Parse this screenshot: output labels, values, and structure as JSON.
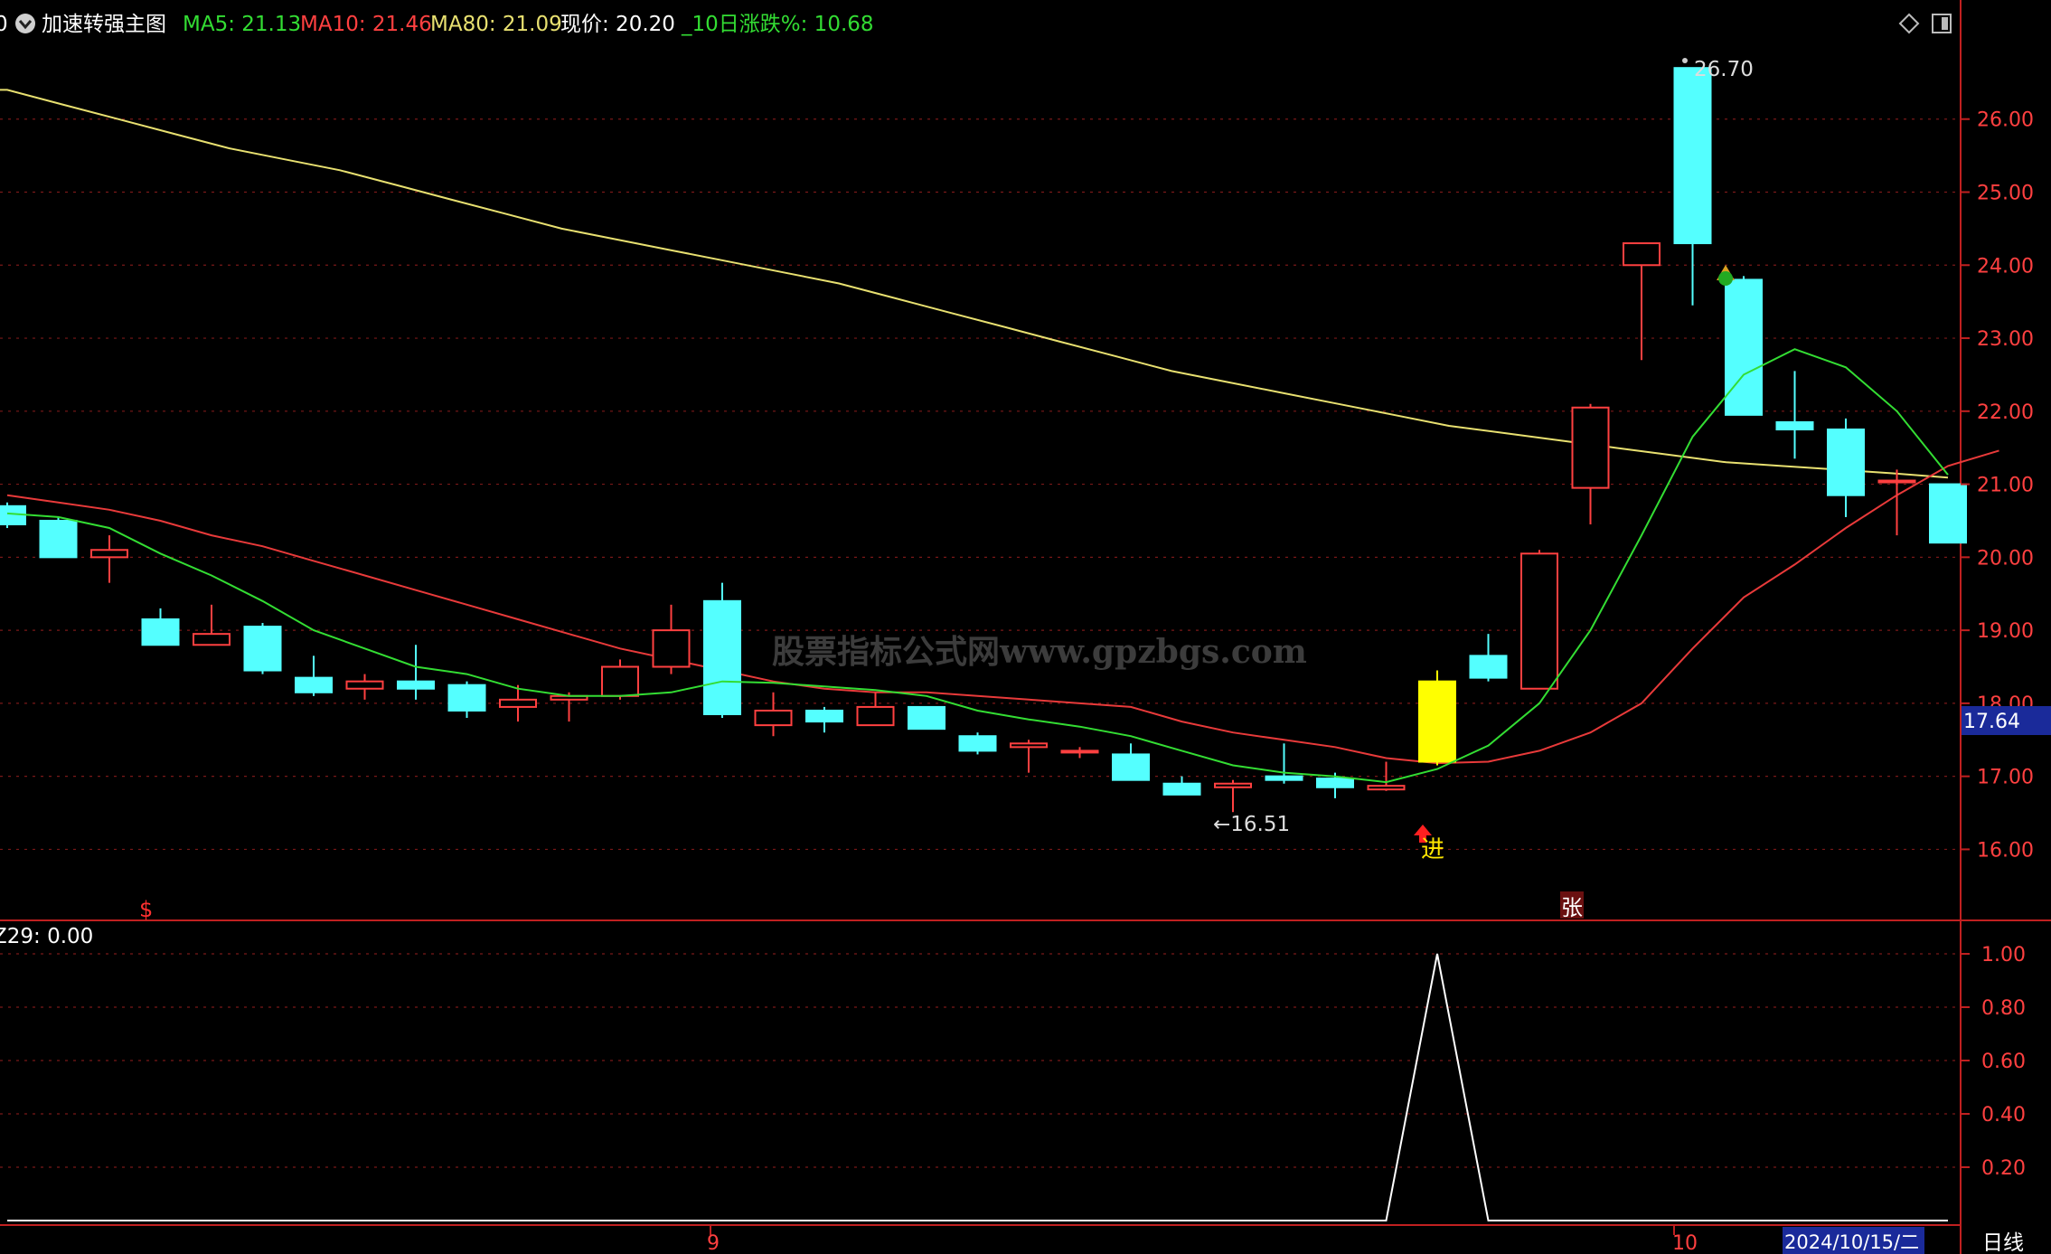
{
  "header": {
    "prefix": "0",
    "title": "加速转强主图",
    "ma5_label": "MA5: 21.13",
    "ma10_label": "MA10: 21.46",
    "ma80_label": "MA80: 21.09",
    "price_label": "现价: 20.20",
    "change_label": "_10日涨跌%: 10.68"
  },
  "colors": {
    "up": "#ff4040",
    "down": "#54ffff",
    "signal": "#ffff00",
    "ma5": "#33dd33",
    "ma10": "#e83a3a",
    "ma80": "#e8e070",
    "axis": "#c02020",
    "grid": "#7a1818",
    "osc": "#ffffff"
  },
  "watermark": "股票指标公式网www.gpzbgs.com",
  "annotations": {
    "high": "26.70",
    "low": "←16.51",
    "enter_signal": "进",
    "rise_signal": "张",
    "s_marker": "$",
    "price_box": "17.64"
  },
  "bottom_panel": {
    "label": "Z29: 0.00"
  },
  "x_axis": {
    "month1": "9",
    "month2": "10",
    "date_box": "2024/10/15/二",
    "period_button": "日线"
  },
  "chart_data": [
    {
      "type": "candlestick",
      "ylim": [
        15.25,
        26.95
      ],
      "yticks": [
        16.0,
        17.0,
        18.0,
        19.0,
        20.0,
        21.0,
        22.0,
        23.0,
        24.0,
        25.0,
        26.0
      ],
      "candles": [
        {
          "o": 20.7,
          "h": 20.75,
          "l": 20.4,
          "c": 20.45
        },
        {
          "o": 20.5,
          "h": 20.55,
          "l": 20.0,
          "c": 20.0
        },
        {
          "o": 20.0,
          "h": 20.3,
          "l": 19.65,
          "c": 20.1
        },
        {
          "o": 19.15,
          "h": 19.3,
          "l": 18.8,
          "c": 18.8
        },
        {
          "o": 18.8,
          "h": 19.35,
          "l": 18.8,
          "c": 18.95
        },
        {
          "o": 19.05,
          "h": 19.1,
          "l": 18.4,
          "c": 18.45
        },
        {
          "o": 18.35,
          "h": 18.65,
          "l": 18.1,
          "c": 18.15
        },
        {
          "o": 18.2,
          "h": 18.4,
          "l": 18.05,
          "c": 18.3
        },
        {
          "o": 18.3,
          "h": 18.8,
          "l": 18.05,
          "c": 18.2
        },
        {
          "o": 18.25,
          "h": 18.3,
          "l": 17.8,
          "c": 17.9
        },
        {
          "o": 17.95,
          "h": 18.25,
          "l": 17.75,
          "c": 18.05
        },
        {
          "o": 18.05,
          "h": 18.15,
          "l": 17.75,
          "c": 18.1
        },
        {
          "o": 18.1,
          "h": 18.6,
          "l": 18.05,
          "c": 18.5
        },
        {
          "o": 18.5,
          "h": 19.35,
          "l": 18.4,
          "c": 19.0
        },
        {
          "o": 19.4,
          "h": 19.65,
          "l": 17.8,
          "c": 17.85
        },
        {
          "o": 17.7,
          "h": 18.15,
          "l": 17.55,
          "c": 17.9
        },
        {
          "o": 17.9,
          "h": 17.95,
          "l": 17.6,
          "c": 17.75
        },
        {
          "o": 17.7,
          "h": 18.15,
          "l": 17.7,
          "c": 17.95
        },
        {
          "o": 17.95,
          "h": 17.95,
          "l": 17.65,
          "c": 17.65
        },
        {
          "o": 17.55,
          "h": 17.6,
          "l": 17.3,
          "c": 17.35
        },
        {
          "o": 17.4,
          "h": 17.5,
          "l": 17.05,
          "c": 17.45
        },
        {
          "o": 17.35,
          "h": 17.4,
          "l": 17.25,
          "c": 17.35
        },
        {
          "o": 17.3,
          "h": 17.45,
          "l": 16.95,
          "c": 16.95
        },
        {
          "o": 16.9,
          "h": 17.0,
          "l": 16.75,
          "c": 16.75
        },
        {
          "o": 16.85,
          "h": 16.95,
          "l": 16.51,
          "c": 16.9
        },
        {
          "o": 17.0,
          "h": 17.45,
          "l": 16.9,
          "c": 16.95
        },
        {
          "o": 16.97,
          "h": 17.05,
          "l": 16.7,
          "c": 16.85
        },
        {
          "o": 16.82,
          "h": 17.2,
          "l": 16.8,
          "c": 16.87
        },
        {
          "o": 17.2,
          "h": 18.45,
          "l": 17.15,
          "c": 18.3,
          "signal": true
        },
        {
          "o": 18.65,
          "h": 18.95,
          "l": 18.3,
          "c": 18.35
        },
        {
          "o": 18.2,
          "h": 20.1,
          "l": 18.2,
          "c": 20.05
        },
        {
          "o": 20.95,
          "h": 22.1,
          "l": 20.45,
          "c": 22.05
        },
        {
          "o": 24.0,
          "h": 24.3,
          "l": 22.7,
          "c": 24.3
        },
        {
          "o": 26.7,
          "h": 26.7,
          "l": 23.45,
          "c": 24.3
        },
        {
          "o": 23.8,
          "h": 23.85,
          "l": 21.95,
          "c": 21.95
        },
        {
          "o": 21.85,
          "h": 22.55,
          "l": 21.35,
          "c": 21.75
        },
        {
          "o": 21.75,
          "h": 21.9,
          "l": 20.55,
          "c": 20.85
        },
        {
          "o": 21.05,
          "h": 21.2,
          "l": 20.3,
          "c": 21.05
        },
        {
          "o": 21.0,
          "h": 21.0,
          "l": 20.2,
          "c": 20.2
        }
      ],
      "series": [
        {
          "name": "MA5",
          "values": [
            20.6,
            20.55,
            20.4,
            20.05,
            19.75,
            19.4,
            19.0,
            18.75,
            18.5,
            18.4,
            18.2,
            18.1,
            18.1,
            18.15,
            18.3,
            18.28,
            18.23,
            18.18,
            18.1,
            17.9,
            17.78,
            17.68,
            17.55,
            17.35,
            17.15,
            17.05,
            17.0,
            16.92,
            17.1,
            17.42,
            18.0,
            19.0,
            20.3,
            21.65,
            22.5,
            22.85,
            22.6,
            22.0,
            21.13
          ]
        },
        {
          "name": "MA10",
          "values": [
            20.85,
            20.75,
            20.65,
            20.5,
            20.3,
            20.15,
            19.95,
            19.75,
            19.55,
            19.35,
            19.15,
            18.95,
            18.75,
            18.6,
            18.45,
            18.3,
            18.2,
            18.15,
            18.15,
            18.1,
            18.05,
            18.0,
            17.95,
            17.75,
            17.6,
            17.5,
            17.4,
            17.25,
            17.18,
            17.2,
            17.35,
            17.6,
            18.0,
            18.75,
            19.45,
            19.9,
            20.4,
            20.85,
            21.25,
            21.46
          ]
        },
        {
          "name": "MA80",
          "values": [
            26.4,
            26.2,
            26.0,
            25.8,
            25.6,
            25.45,
            25.3,
            25.1,
            24.9,
            24.7,
            24.5,
            24.35,
            24.2,
            24.05,
            23.9,
            23.75,
            23.55,
            23.35,
            23.15,
            22.95,
            22.75,
            22.55,
            22.4,
            22.25,
            22.1,
            21.95,
            21.8,
            21.7,
            21.6,
            21.5,
            21.4,
            21.3,
            21.25,
            21.2,
            21.15,
            21.09
          ]
        }
      ]
    },
    {
      "type": "line",
      "name": "Z29",
      "ylim": [
        0,
        1.0
      ],
      "yticks": [
        0.2,
        0.4,
        0.6,
        0.8,
        1.0
      ],
      "values": [
        0,
        0,
        0,
        0,
        0,
        0,
        0,
        0,
        0,
        0,
        0,
        0,
        0,
        0,
        0,
        0,
        0,
        0,
        0,
        0,
        0,
        0,
        0,
        0,
        0,
        0,
        0,
        0,
        1,
        0,
        0,
        0,
        0,
        0,
        0,
        0,
        0,
        0,
        0
      ]
    }
  ]
}
